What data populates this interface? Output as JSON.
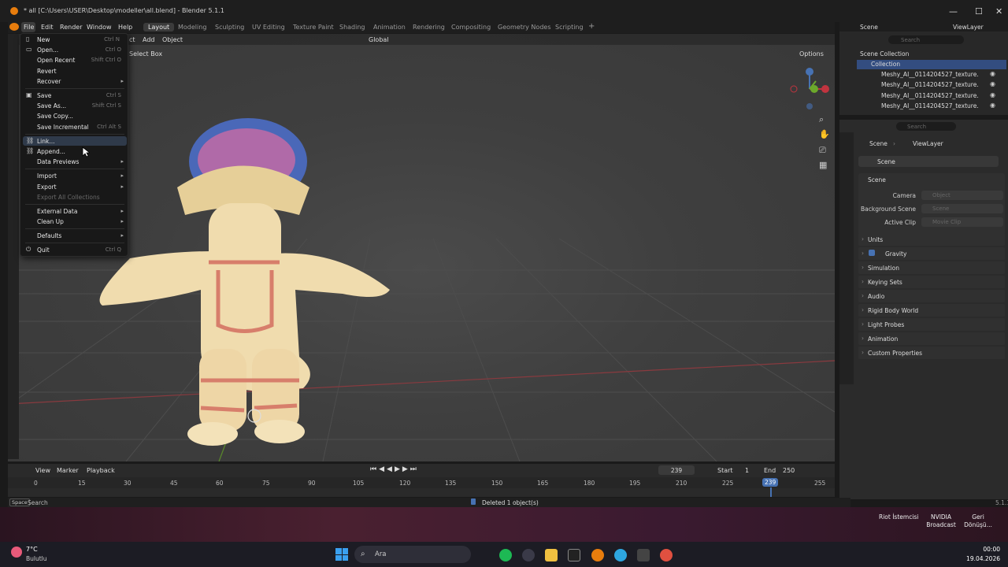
{
  "window": {
    "title": "* all [C:\\Users\\USER\\Desktop\\modeller\\all.blend] - Blender 5.1.1",
    "minimize": "—",
    "maximize": "☐",
    "close": "✕"
  },
  "menubar": {
    "items": [
      "File",
      "Edit",
      "Render",
      "Window",
      "Help"
    ],
    "workspaces": [
      "Layout",
      "Modeling",
      "Sculpting",
      "UV Editing",
      "Texture Paint",
      "Shading",
      "Animation",
      "Rendering",
      "Compositing",
      "Geometry Nodes",
      "Scripting"
    ],
    "add_tab": "+"
  },
  "viewport_header": {
    "menu_object": "Object",
    "menu_add": "Add",
    "menu_select_partial": "ct",
    "select_box": "Select Box",
    "transform_orientation": "Global",
    "options": "Options"
  },
  "file_menu": {
    "items": [
      {
        "label": "New",
        "shortcut": "Ctrl N",
        "submenu": true,
        "icon": "file-new-icon"
      },
      {
        "label": "Open...",
        "shortcut": "Ctrl O",
        "icon": "folder-icon"
      },
      {
        "label": "Open Recent",
        "shortcut": "Shift Ctrl O",
        "submenu": true
      },
      {
        "label": "Revert"
      },
      {
        "label": "Recover",
        "submenu": true
      },
      {
        "label": "Save",
        "shortcut": "Ctrl S",
        "icon": "save-icon"
      },
      {
        "label": "Save As...",
        "shortcut": "Shift Ctrl S"
      },
      {
        "label": "Save Copy..."
      },
      {
        "label": "Save Incremental",
        "shortcut": "Ctrl Alt S"
      },
      {
        "label": "Link...",
        "icon": "link-icon",
        "highlighted": true
      },
      {
        "label": "Append...",
        "icon": "append-icon"
      },
      {
        "label": "Data Previews",
        "submenu": true
      },
      {
        "label": "Import",
        "submenu": true
      },
      {
        "label": "Export",
        "submenu": true
      },
      {
        "label": "Export All Collections",
        "disabled": true
      },
      {
        "label": "External Data",
        "submenu": true
      },
      {
        "label": "Clean Up",
        "submenu": true
      },
      {
        "label": "Defaults",
        "submenu": true
      },
      {
        "label": "Quit",
        "shortcut": "Ctrl Q",
        "icon": "power-icon"
      }
    ]
  },
  "outliner": {
    "scene": "Scene",
    "view_layer": "ViewLayer",
    "search_placeholder": "Search",
    "scene_collection": "Scene Collection",
    "collection": "Collection",
    "objects": [
      "Meshy_AI__0114204527_texture.",
      "Meshy_AI__0114204527_texture.",
      "Meshy_AI__0114204527_texture.",
      "Meshy_AI__0114204527_texture."
    ]
  },
  "properties": {
    "search_placeholder": "Search",
    "breadcrumb": [
      "Scene",
      "ViewLayer"
    ],
    "datablock": "Scene",
    "panel_title": "Scene",
    "fields": [
      {
        "label": "Camera",
        "placeholder": "Object"
      },
      {
        "label": "Background Scene",
        "placeholder": "Scene"
      },
      {
        "label": "Active Clip",
        "placeholder": "Movie Clip"
      }
    ],
    "panels": [
      "Units",
      "Gravity",
      "Simulation",
      "Keying Sets",
      "Audio",
      "Rigid Body World",
      "Light Probes",
      "Animation",
      "Custom Properties"
    ],
    "gravity_checked": true
  },
  "timeline": {
    "menus": [
      "View",
      "Marker",
      "Playback"
    ],
    "current_frame": "239",
    "start_label": "Start",
    "start": "1",
    "end_label": "End",
    "end": "250",
    "ticks": [
      "0",
      "15",
      "30",
      "45",
      "60",
      "75",
      "90",
      "105",
      "120",
      "135",
      "150",
      "165",
      "180",
      "195",
      "210",
      "225",
      "239",
      "255"
    ]
  },
  "status": {
    "key": "Space",
    "key_action": "Search",
    "message": "Deleted 1 object(s)",
    "version": "5.1.1"
  },
  "desktop": {
    "riot": "Riot İstemcisi",
    "nvidia": "NVIDIA Broadcast",
    "geri": "Geri Dönüşü..."
  },
  "taskbar": {
    "weather_temp": "7°C",
    "weather_desc": "Bulutlu",
    "search_placeholder": "Ara",
    "time": "00:00",
    "date": "19.04.2026"
  },
  "colors": {
    "accent_blue": "#4772b3",
    "blender_orange": "#e87d0d",
    "axis_red": "#c1343f",
    "axis_green": "#6ca82b"
  }
}
